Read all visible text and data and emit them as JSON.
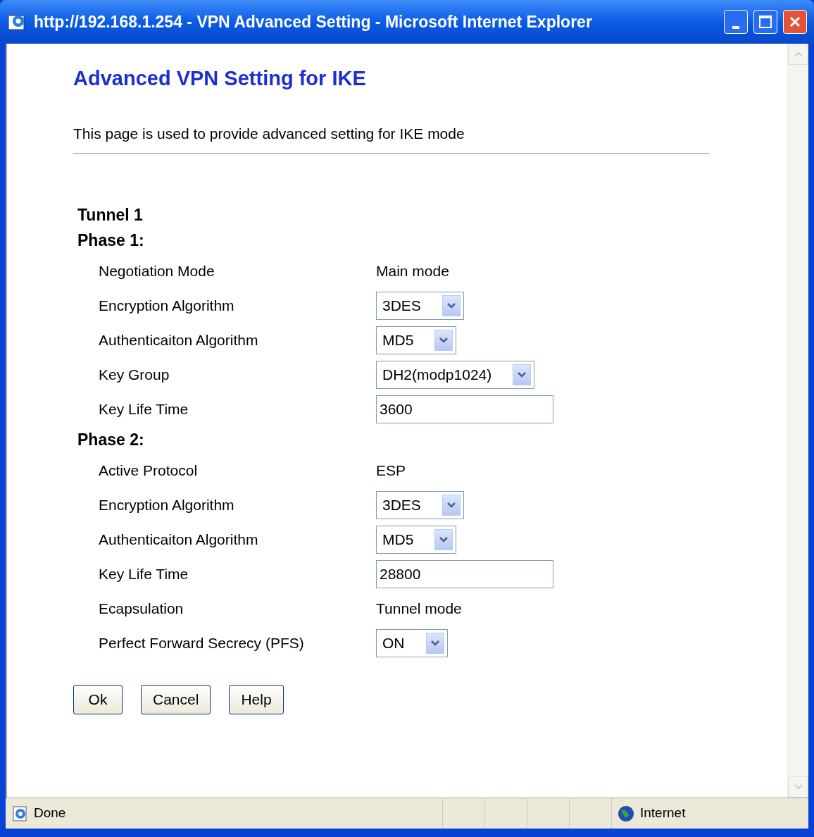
{
  "window": {
    "title": "http://192.168.1.254 - VPN Advanced Setting - Microsoft Internet Explorer"
  },
  "page": {
    "heading": "Advanced VPN Setting for IKE",
    "description": "This page is used to provide advanced setting for IKE mode",
    "tunnel": "Tunnel 1",
    "sections": [
      {
        "title": "Phase 1:",
        "rows": [
          {
            "label": "Negotiation Mode",
            "kind": "text",
            "value": "Main mode"
          },
          {
            "label": "Encryption Algorithm",
            "kind": "select",
            "value": "3DES"
          },
          {
            "label": "Authenticaiton Algorithm",
            "kind": "select",
            "value": "MD5"
          },
          {
            "label": "Key Group",
            "kind": "select",
            "value": "DH2(modp1024)"
          },
          {
            "label": "Key Life Time",
            "kind": "input",
            "value": "3600"
          }
        ]
      },
      {
        "title": "Phase 2:",
        "rows": [
          {
            "label": "Active Protocol",
            "kind": "text",
            "value": "ESP"
          },
          {
            "label": "Encryption Algorithm",
            "kind": "select",
            "value": "3DES"
          },
          {
            "label": "Authenticaiton Algorithm",
            "kind": "select",
            "value": "MD5"
          },
          {
            "label": "Key Life Time",
            "kind": "input",
            "value": "28800"
          },
          {
            "label": "Ecapsulation",
            "kind": "text",
            "value": "Tunnel mode"
          },
          {
            "label": "Perfect Forward Secrecy (PFS)",
            "kind": "select",
            "value": "ON"
          }
        ]
      }
    ],
    "buttons": [
      "Ok",
      "Cancel",
      "Help"
    ]
  },
  "status_bar": {
    "status": "Done",
    "zone": "Internet"
  }
}
